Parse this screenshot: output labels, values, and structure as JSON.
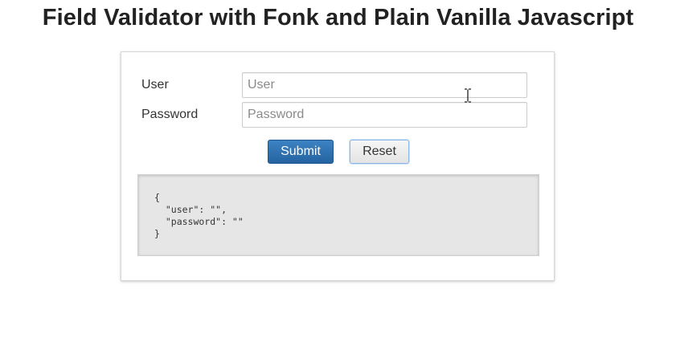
{
  "header": {
    "title": "Field Validator with Fonk and Plain Vanilla Javascript"
  },
  "form": {
    "user_label": "User",
    "user_value": "",
    "user_placeholder": "User",
    "password_label": "Password",
    "password_value": "",
    "password_placeholder": "Password",
    "submit_label": "Submit",
    "reset_label": "Reset"
  },
  "output": {
    "json_text": "{\n  \"user\": \"\",\n  \"password\": \"\"\n}"
  },
  "colors": {
    "submit_bg": "#2f72b4",
    "reset_border": "#8bb6e6",
    "output_bg": "#e6e6e6"
  },
  "icons": {
    "cursor": "text-cursor-icon"
  }
}
